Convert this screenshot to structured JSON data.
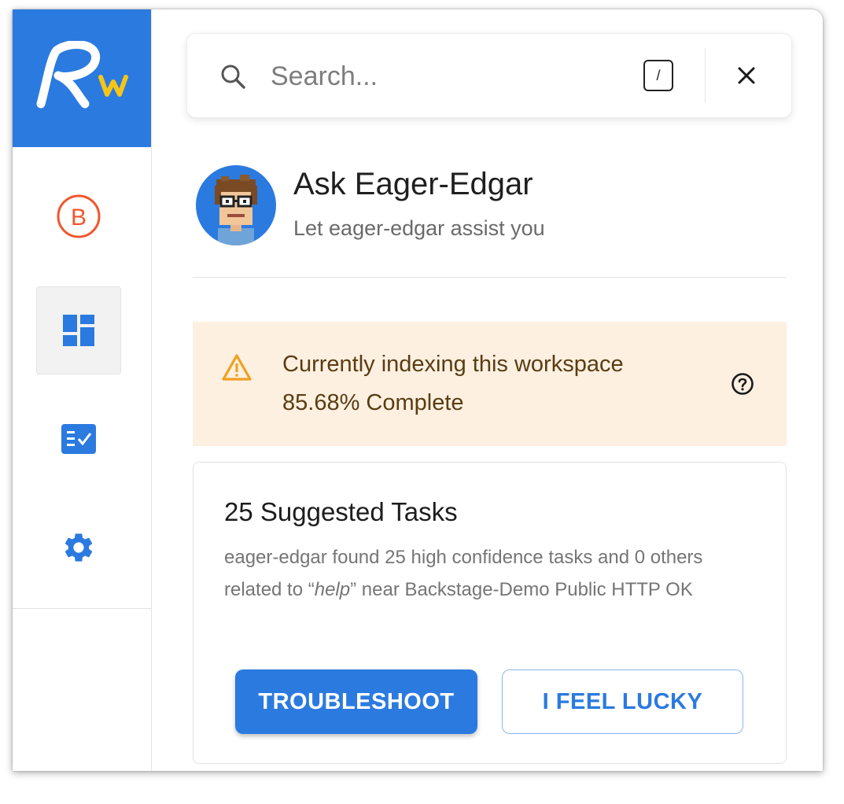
{
  "sidebar": {
    "logo_text": "RW",
    "items": [
      {
        "icon": "b-circle-icon",
        "active": false
      },
      {
        "icon": "dashboard-icon",
        "active": true
      },
      {
        "icon": "task-list-icon",
        "active": false
      },
      {
        "icon": "gear-icon",
        "active": false
      }
    ]
  },
  "search": {
    "placeholder": "Search...",
    "shortcut": "/",
    "close_icon": "close-icon"
  },
  "assistant": {
    "title": "Ask Eager-Edgar",
    "subtitle": "Let eager-edgar assist you"
  },
  "indexing": {
    "line1": "Currently indexing this workspace",
    "line2": "85.68% Complete",
    "percent": 85.68,
    "icon": "warning-icon",
    "help_icon": "help-circle-icon"
  },
  "suggestions": {
    "title": "25 Suggested Tasks",
    "desc_before": "eager-edgar found 25 high confidence tasks and 0 others related to “",
    "desc_query": "help",
    "desc_after": "” near Backstage-Demo Public HTTP OK",
    "troubleshoot_label": "TROUBLESHOOT",
    "lucky_label": "I FEEL LUCKY"
  },
  "colors": {
    "accent": "#2b7ae0",
    "alert_bg": "#fdf0e1",
    "warning": "#f0a020",
    "b_icon": "#f0572e"
  }
}
